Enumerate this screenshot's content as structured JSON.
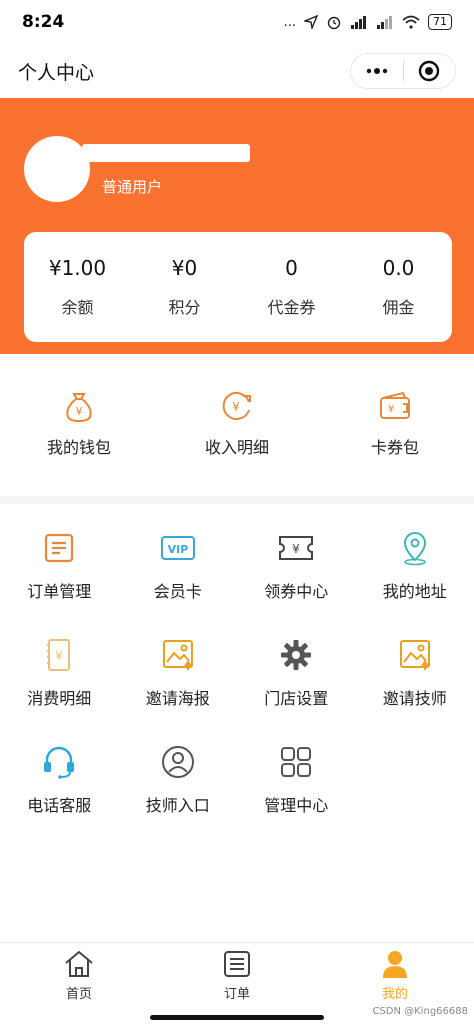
{
  "status_bar": {
    "time": "8:24",
    "dots": "...",
    "battery": "71"
  },
  "nav": {
    "title": "个人中心"
  },
  "profile": {
    "level": "普通用户"
  },
  "stats": [
    {
      "value": "¥1.00",
      "label": "余额"
    },
    {
      "value": "¥0",
      "label": "积分"
    },
    {
      "value": "0",
      "label": "代金券"
    },
    {
      "value": "0.0",
      "label": "佣金"
    }
  ],
  "wallet": [
    {
      "label": "我的钱包",
      "icon": "money-bag-icon"
    },
    {
      "label": "收入明细",
      "icon": "income-icon"
    },
    {
      "label": "卡券包",
      "icon": "card-wallet-icon"
    }
  ],
  "grid": [
    {
      "label": "订单管理",
      "icon": "order-icon"
    },
    {
      "label": "会员卡",
      "icon": "vip-card-icon"
    },
    {
      "label": "领券中心",
      "icon": "coupon-icon"
    },
    {
      "label": "我的地址",
      "icon": "location-icon"
    },
    {
      "label": "消费明细",
      "icon": "receipt-icon"
    },
    {
      "label": "邀请海报",
      "icon": "poster-icon"
    },
    {
      "label": "门店设置",
      "icon": "gear-icon"
    },
    {
      "label": "邀请技师",
      "icon": "poster-icon"
    },
    {
      "label": "电话客服",
      "icon": "headset-icon"
    },
    {
      "label": "技师入口",
      "icon": "user-icon"
    },
    {
      "label": "管理中心",
      "icon": "grid-icon"
    }
  ],
  "tabs": [
    {
      "label": "首页",
      "icon": "home-icon"
    },
    {
      "label": "订单",
      "icon": "list-icon"
    },
    {
      "label": "我的",
      "icon": "person-icon",
      "active": true
    }
  ],
  "watermark": "CSDN @King66688",
  "colors": {
    "brand": "#f97230",
    "accent": "#f5a623",
    "teal": "#3db6b0",
    "icon_orange": "#e8883a"
  }
}
